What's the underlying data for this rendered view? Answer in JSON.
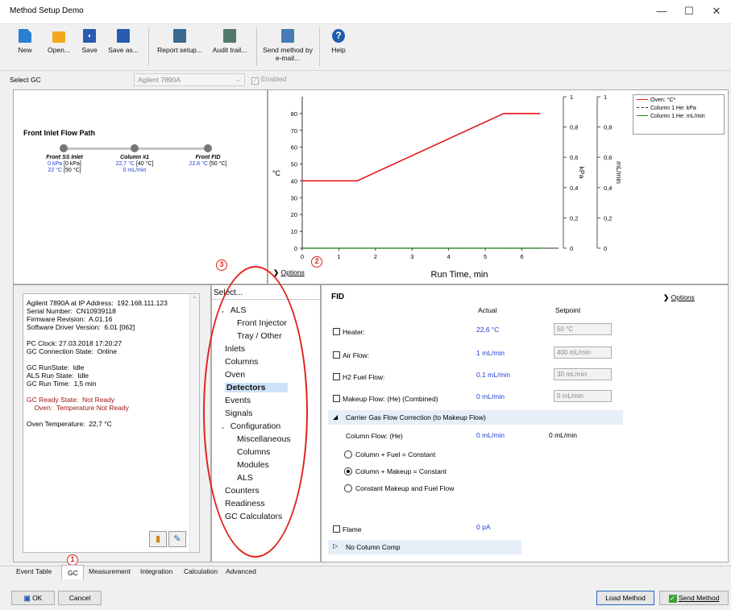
{
  "window": {
    "title": "Method Setup Demo",
    "minimize": "—",
    "maximize": "☐",
    "close": "✕"
  },
  "toolbar": {
    "new": "New",
    "open": "Open...",
    "save": "Save",
    "save_as": "Save as...",
    "report_setup": "Report setup...",
    "audit_trail": "Audit trail...",
    "send_method_line1": "Send method by",
    "send_method_line2": "e-mail...",
    "help": "Help"
  },
  "select_gc": {
    "label": "Select GC",
    "value": "Agilent 7890A",
    "enabled_label": "Enabled"
  },
  "flow_path": {
    "title": "Front Inlet Flow Path",
    "nodes": [
      {
        "name": "Front SS Inlet",
        "line1_blue": "0 kPa",
        "line1_rest": " [0 kPa]",
        "line2_blue": "22 °C",
        "line2_rest": " [50 °C]"
      },
      {
        "name": "Column #1",
        "line1_blue": "22,7 °C",
        "line1_rest": " [40 °C]",
        "line2_blue": "0 mL/min",
        "line2_rest": ""
      },
      {
        "name": "Front FID",
        "line1_blue": "22,6 °C",
        "line1_rest": " [50 °C]",
        "line2_blue": "",
        "line2_rest": ""
      }
    ]
  },
  "chart_data": {
    "type": "line",
    "xlabel": "Run Time, min",
    "ylabel": "°C",
    "ylabel_right1": "kPa",
    "ylabel_right2": "mL/min",
    "xlim": [
      0,
      7
    ],
    "ylim": [
      0,
      90
    ],
    "xticks": [
      "0",
      "1",
      "2",
      "3",
      "4",
      "5",
      "6"
    ],
    "yticks": [
      "0",
      "10",
      "20",
      "30",
      "40",
      "50",
      "60",
      "70",
      "80"
    ],
    "right1_ticks": [
      "0",
      "0,2",
      "0,4",
      "0,6",
      "0,8",
      "1"
    ],
    "right2_ticks": [
      "0",
      "0,2",
      "0,4",
      "0,6",
      "0,8",
      "1"
    ],
    "series": [
      {
        "name": "Oven: °C*",
        "color": "#e8141a",
        "x": [
          0,
          1.5,
          5.5,
          6.5
        ],
        "y": [
          40,
          40,
          80,
          80
        ]
      },
      {
        "name": "Column 1 He: kPa",
        "color": "#333333",
        "x": [
          0,
          6.5
        ],
        "y": [
          0,
          0
        ]
      },
      {
        "name": "Column 1 He: mL/min",
        "color": "#1c8a1c",
        "x": [
          0,
          6.5
        ],
        "y": [
          0,
          0
        ]
      }
    ],
    "legend": "top-right",
    "options_label": "Options"
  },
  "status": {
    "lines": [
      {
        "text": "Agilent 7890A at IP Address:  192.168.111.123",
        "color": "#000"
      },
      {
        "text": "Serial Number:  CN10939118",
        "color": "#000"
      },
      {
        "text": "Firmware Revision:  A.01.16",
        "color": "#000"
      },
      {
        "text": "Software Driver Version:  6.01 [062]",
        "color": "#000"
      },
      {
        "text": "",
        "color": "#000"
      },
      {
        "text": "PC Clock: 27.03.2018 17:20:27",
        "color": "#000"
      },
      {
        "text": "GC Connection State:  Online",
        "color": "#000"
      },
      {
        "text": "",
        "color": "#000"
      },
      {
        "text": "GC RunState:  Idle",
        "color": "#000"
      },
      {
        "text": "ALS Run State:  Idle",
        "color": "#000"
      },
      {
        "text": "GC Run Time:  1,5 min",
        "color": "#000"
      },
      {
        "text": "",
        "color": "#000"
      },
      {
        "text": "GC Ready State:  Not Ready",
        "color": "#a31515"
      },
      {
        "text": "    Oven:  Temperature Not Ready",
        "color": "#a31515"
      },
      {
        "text": "",
        "color": "#000"
      },
      {
        "text": "Oven Temperature:  22,7 °C",
        "color": "#000"
      }
    ]
  },
  "tree": {
    "header": "Select...",
    "items": [
      {
        "label": "ALS",
        "level": 0,
        "expander": "⌄"
      },
      {
        "label": "Front Injector",
        "level": 2
      },
      {
        "label": "Tray / Other",
        "level": 2
      },
      {
        "label": "Inlets",
        "level": 1
      },
      {
        "label": "Columns",
        "level": 1
      },
      {
        "label": "Oven",
        "level": 1
      },
      {
        "label": "Detectors",
        "level": 1,
        "selected": true
      },
      {
        "label": "Events",
        "level": 1
      },
      {
        "label": "Signals",
        "level": 1
      },
      {
        "label": "Configuration",
        "level": 0,
        "expander": "⌄"
      },
      {
        "label": "Miscellaneous",
        "level": 2
      },
      {
        "label": "Columns",
        "level": 2
      },
      {
        "label": "Modules",
        "level": 2
      },
      {
        "label": "ALS",
        "level": 2
      },
      {
        "label": "Counters",
        "level": 1
      },
      {
        "label": "Readiness",
        "level": 1
      },
      {
        "label": "GC Calculators",
        "level": 1
      }
    ]
  },
  "fid": {
    "title": "FID",
    "options_label": "Options",
    "col_actual": "Actual",
    "col_setpoint": "Setpoint",
    "heater": {
      "label": "Heater:",
      "actual": "22,6 °C",
      "setpoint": "50 °C"
    },
    "air": {
      "label": "Air Flow:",
      "actual": "1 mL/min",
      "setpoint": "400 mL/min"
    },
    "h2": {
      "label": "H2 Fuel Flow:",
      "actual": "0,1 mL/min",
      "setpoint": "30 mL/min"
    },
    "makeup": {
      "label": "Makeup Flow: (He) (Combined)",
      "actual": "0 mL/min",
      "setpoint": "0 mL/min"
    },
    "carrier_section": "Carrier Gas Flow Correction (to Makeup Flow)",
    "column_flow_label": "Column Flow: (He)",
    "column_flow_actual": "0 mL/min",
    "column_flow_setpoint": "0 mL/min",
    "radio1": "Column + Fuel = Constant",
    "radio2": "Column + Makeup = Constant",
    "radio3": "Constant Makeup and Fuel Flow",
    "flame": {
      "label": "Flame",
      "actual": "0 pA"
    },
    "no_column_comp": "No Column Comp"
  },
  "tabs": [
    "Event Table",
    "GC",
    "Measurement",
    "Integration",
    "Calculation",
    "Advanced"
  ],
  "buttons": {
    "ok": "OK",
    "cancel": "Cancel",
    "load_method": "Load Method",
    "send_method": "Send Method"
  },
  "annotations": [
    "1",
    "2",
    "3"
  ]
}
